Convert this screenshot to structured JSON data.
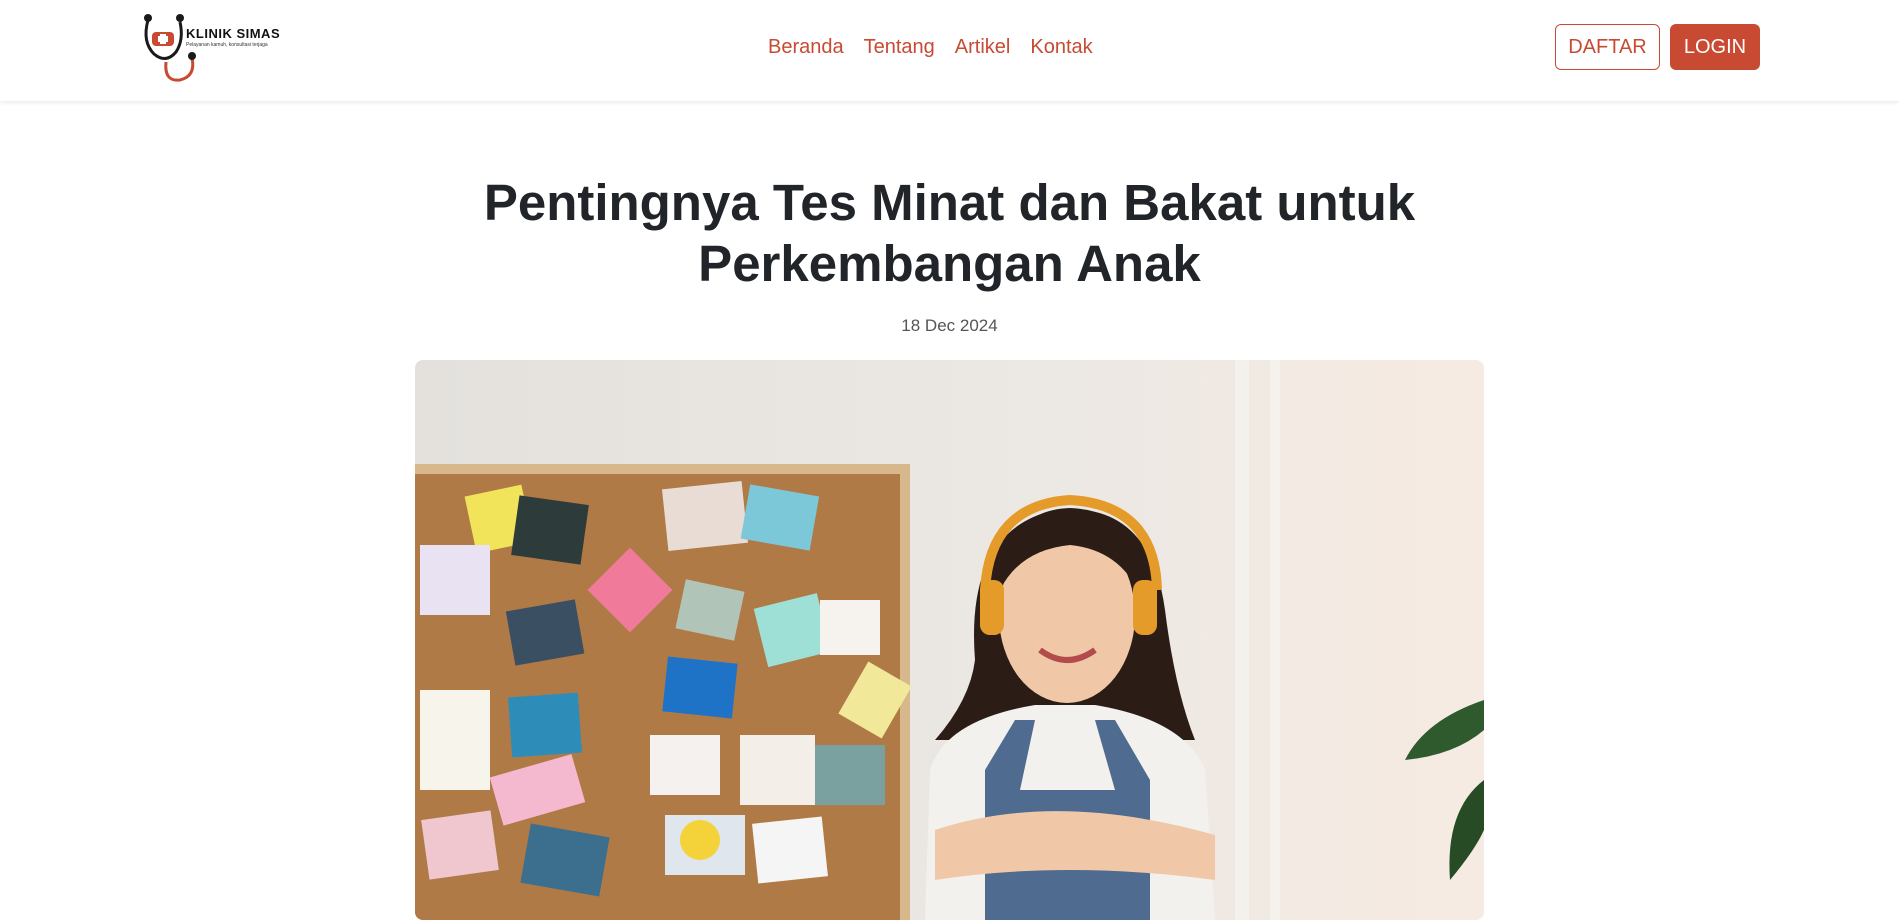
{
  "header": {
    "brand": {
      "name": "KLINIK SIMAS",
      "tagline": "Pelayanan kamuh, konsultasi terjaga"
    },
    "nav": [
      {
        "label": "Beranda"
      },
      {
        "label": "Tentang"
      },
      {
        "label": "Artikel"
      },
      {
        "label": "Kontak"
      }
    ],
    "buttons": {
      "register": "DAFTAR",
      "login": "LOGIN"
    }
  },
  "article": {
    "title_line1": "Pentingnya Tes Minat dan Bakat untuk",
    "title_line2": "Perkembangan Anak",
    "date": "18 Dec 2024"
  },
  "colors": {
    "accent": "#c84a33",
    "text": "#212529",
    "muted": "#555555"
  },
  "icons": [
    "stethoscope-logo-icon"
  ]
}
